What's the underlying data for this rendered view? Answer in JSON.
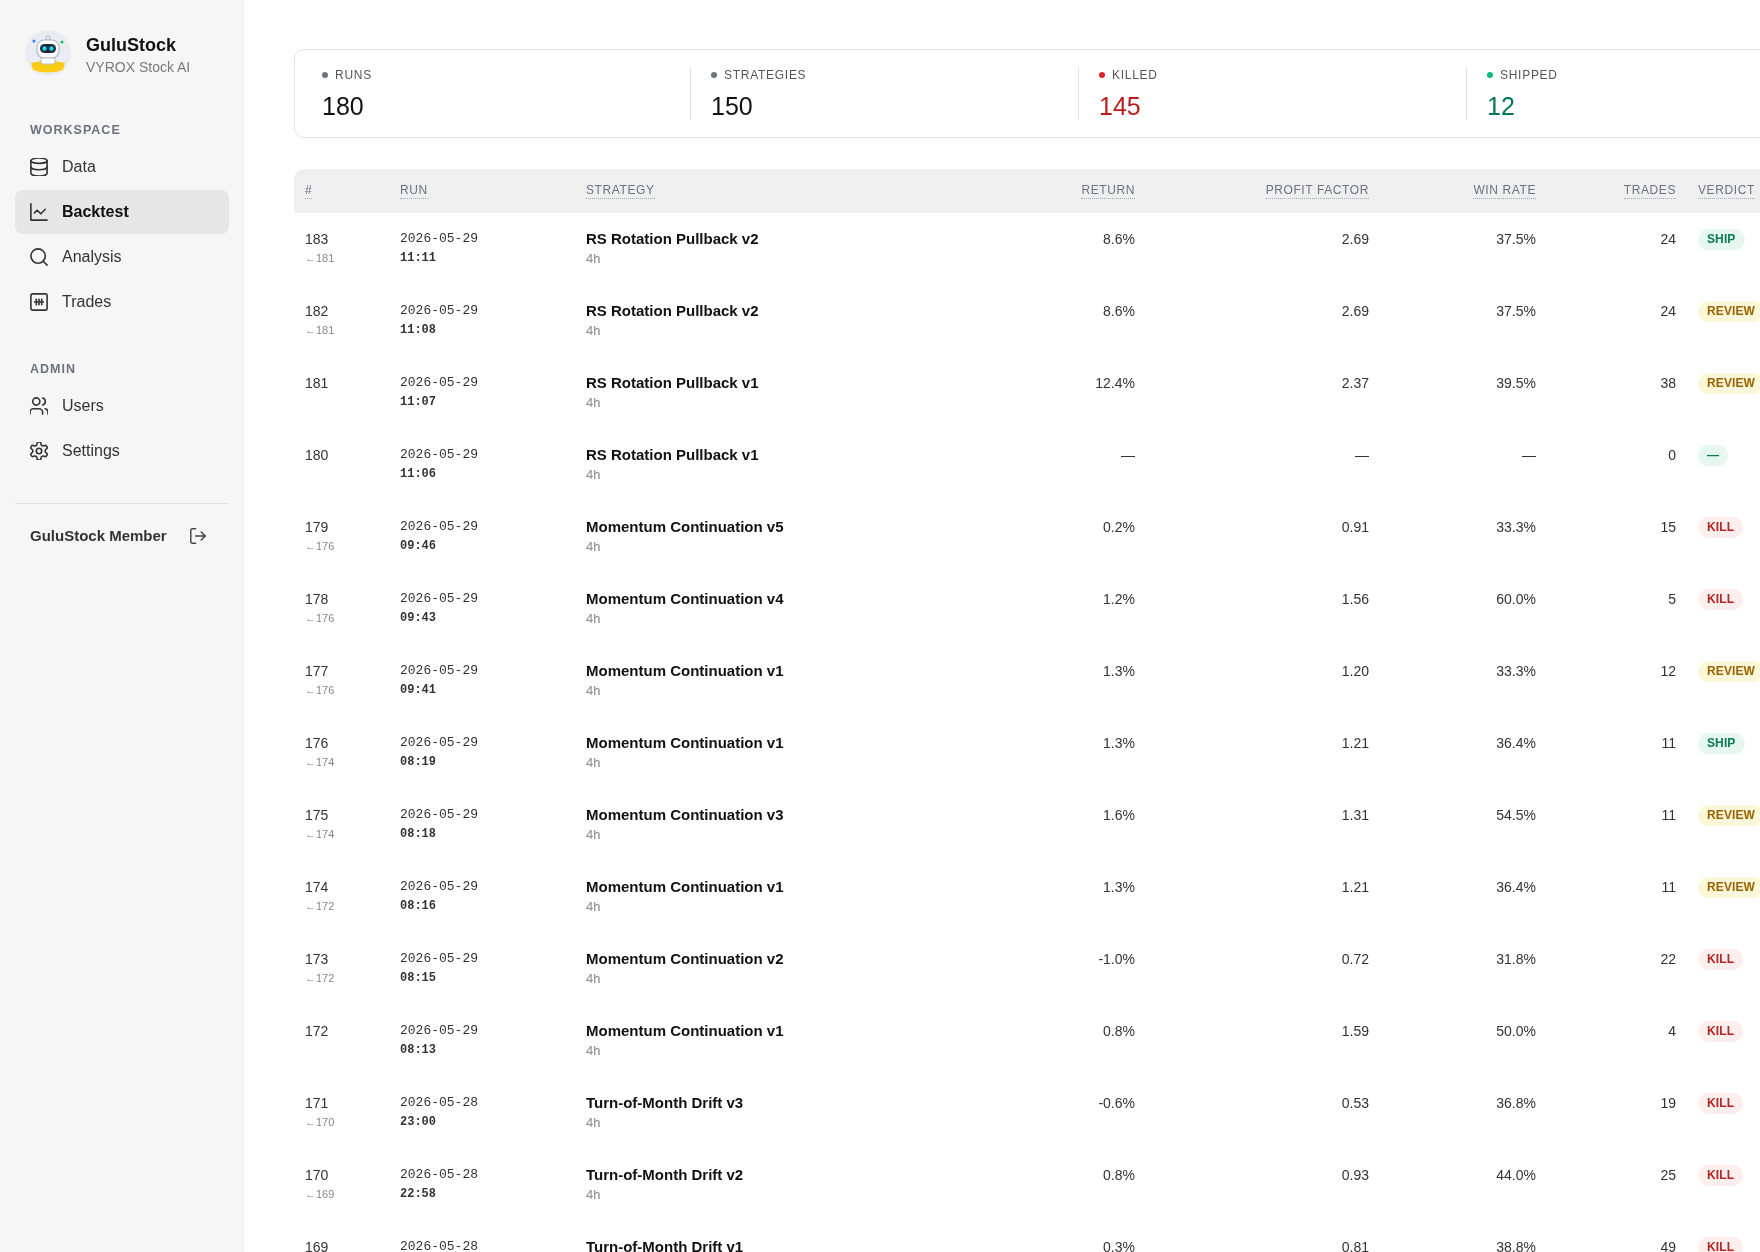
{
  "sidebar": {
    "brand": {
      "name": "GuluStock",
      "subtitle": "VYROX Stock AI"
    },
    "sections": [
      {
        "title": "WORKSPACE",
        "items": [
          {
            "label": "Data",
            "selected": false
          },
          {
            "label": "Backtest",
            "selected": true
          },
          {
            "label": "Analysis",
            "selected": false
          },
          {
            "label": "Trades",
            "selected": false
          }
        ]
      },
      {
        "title": "ADMIN",
        "items": [
          {
            "label": "Users",
            "selected": false
          },
          {
            "label": "Settings",
            "selected": false
          }
        ]
      }
    ],
    "footer": {
      "user": "GuluStock Member"
    }
  },
  "stats": [
    {
      "label": "RUNS",
      "value": "180",
      "color": "#6b7280",
      "kind": "neutral"
    },
    {
      "label": "STRATEGIES",
      "value": "150",
      "color": "#6b7280",
      "kind": "neutral"
    },
    {
      "label": "KILLED",
      "value": "145",
      "color": "#dc2626",
      "kind": "negative"
    },
    {
      "label": "SHIPPED",
      "value": "12",
      "color": "#10b981",
      "kind": "positive"
    }
  ],
  "table": {
    "columns": [
      "#",
      "RUN",
      "STRATEGY",
      "RETURN",
      "PROFIT FACTOR",
      "WIN RATE",
      "TRADES",
      "VERDICT"
    ],
    "rows": [
      {
        "id": "183",
        "parent": "←181",
        "date": "2026-05-29",
        "time": "11:11",
        "strategy": "RS Rotation Pullback v2",
        "timeframe": "4h",
        "return": "8.6%",
        "profit_factor": "2.69",
        "win_rate": "37.5%",
        "trades": "24",
        "verdict": {
          "label": "SHIP",
          "kind": "ship"
        }
      },
      {
        "id": "182",
        "parent": "←181",
        "date": "2026-05-29",
        "time": "11:08",
        "strategy": "RS Rotation Pullback v2",
        "timeframe": "4h",
        "return": "8.6%",
        "profit_factor": "2.69",
        "win_rate": "37.5%",
        "trades": "24",
        "verdict": {
          "label": "REVIEW",
          "kind": "review"
        }
      },
      {
        "id": "181",
        "date": "2026-05-29",
        "time": "11:07",
        "strategy": "RS Rotation Pullback v1",
        "timeframe": "4h",
        "return": "12.4%",
        "profit_factor": "2.37",
        "win_rate": "39.5%",
        "trades": "38",
        "verdict": {
          "label": "REVIEW",
          "kind": "review"
        }
      },
      {
        "id": "180",
        "date": "2026-05-29",
        "time": "11:06",
        "strategy": "RS Rotation Pullback v1",
        "timeframe": "4h",
        "return": "—",
        "profit_factor": "—",
        "win_rate": "—",
        "trades": "0",
        "verdict": {
          "label": "—",
          "kind": "pending"
        }
      },
      {
        "id": "179",
        "parent": "←176",
        "date": "2026-05-29",
        "time": "09:46",
        "strategy": "Momentum Continuation v5",
        "timeframe": "4h",
        "return": "0.2%",
        "profit_factor": "0.91",
        "win_rate": "33.3%",
        "trades": "15",
        "verdict": {
          "label": "KILL",
          "kind": "kill"
        }
      },
      {
        "id": "178",
        "parent": "←176",
        "date": "2026-05-29",
        "time": "09:43",
        "strategy": "Momentum Continuation v4",
        "timeframe": "4h",
        "return": "1.2%",
        "profit_factor": "1.56",
        "win_rate": "60.0%",
        "trades": "5",
        "verdict": {
          "label": "KILL",
          "kind": "kill"
        }
      },
      {
        "id": "177",
        "parent": "←176",
        "date": "2026-05-29",
        "time": "09:41",
        "strategy": "Momentum Continuation v1",
        "timeframe": "4h",
        "return": "1.3%",
        "profit_factor": "1.20",
        "win_rate": "33.3%",
        "trades": "12",
        "verdict": {
          "label": "REVIEW",
          "kind": "review"
        }
      },
      {
        "id": "176",
        "parent": "←174",
        "date": "2026-05-29",
        "time": "08:19",
        "strategy": "Momentum Continuation v1",
        "timeframe": "4h",
        "return": "1.3%",
        "profit_factor": "1.21",
        "win_rate": "36.4%",
        "trades": "11",
        "verdict": {
          "label": "SHIP",
          "kind": "ship"
        }
      },
      {
        "id": "175",
        "parent": "←174",
        "date": "2026-05-29",
        "time": "08:18",
        "strategy": "Momentum Continuation v3",
        "timeframe": "4h",
        "return": "1.6%",
        "profit_factor": "1.31",
        "win_rate": "54.5%",
        "trades": "11",
        "verdict": {
          "label": "REVIEW",
          "kind": "review"
        }
      },
      {
        "id": "174",
        "parent": "←172",
        "date": "2026-05-29",
        "time": "08:16",
        "strategy": "Momentum Continuation v1",
        "timeframe": "4h",
        "return": "1.3%",
        "profit_factor": "1.21",
        "win_rate": "36.4%",
        "trades": "11",
        "verdict": {
          "label": "REVIEW",
          "kind": "review"
        }
      },
      {
        "id": "173",
        "parent": "←172",
        "date": "2026-05-29",
        "time": "08:15",
        "strategy": "Momentum Continuation v2",
        "timeframe": "4h",
        "return": "-1.0%",
        "profit_factor": "0.72",
        "win_rate": "31.8%",
        "trades": "22",
        "verdict": {
          "label": "KILL",
          "kind": "kill"
        }
      },
      {
        "id": "172",
        "date": "2026-05-29",
        "time": "08:13",
        "strategy": "Momentum Continuation v1",
        "timeframe": "4h",
        "return": "0.8%",
        "profit_factor": "1.59",
        "win_rate": "50.0%",
        "trades": "4",
        "verdict": {
          "label": "KILL",
          "kind": "kill"
        }
      },
      {
        "id": "171",
        "parent": "←170",
        "date": "2026-05-28",
        "time": "23:00",
        "strategy": "Turn-of-Month Drift v3",
        "timeframe": "4h",
        "return": "-0.6%",
        "profit_factor": "0.53",
        "win_rate": "36.8%",
        "trades": "19",
        "verdict": {
          "label": "KILL",
          "kind": "kill"
        }
      },
      {
        "id": "170",
        "parent": "←169",
        "date": "2026-05-28",
        "time": "22:58",
        "strategy": "Turn-of-Month Drift v2",
        "timeframe": "4h",
        "return": "0.8%",
        "profit_factor": "0.93",
        "win_rate": "44.0%",
        "trades": "25",
        "verdict": {
          "label": "KILL",
          "kind": "kill"
        }
      },
      {
        "id": "169",
        "date": "2026-05-28",
        "strategy": "Turn-of-Month Drift v1",
        "return": "0.3%",
        "profit_factor": "0.81",
        "win_rate": "38.8%",
        "trades": "49",
        "verdict": {
          "label": "KILL",
          "kind": "kill"
        }
      }
    ]
  }
}
